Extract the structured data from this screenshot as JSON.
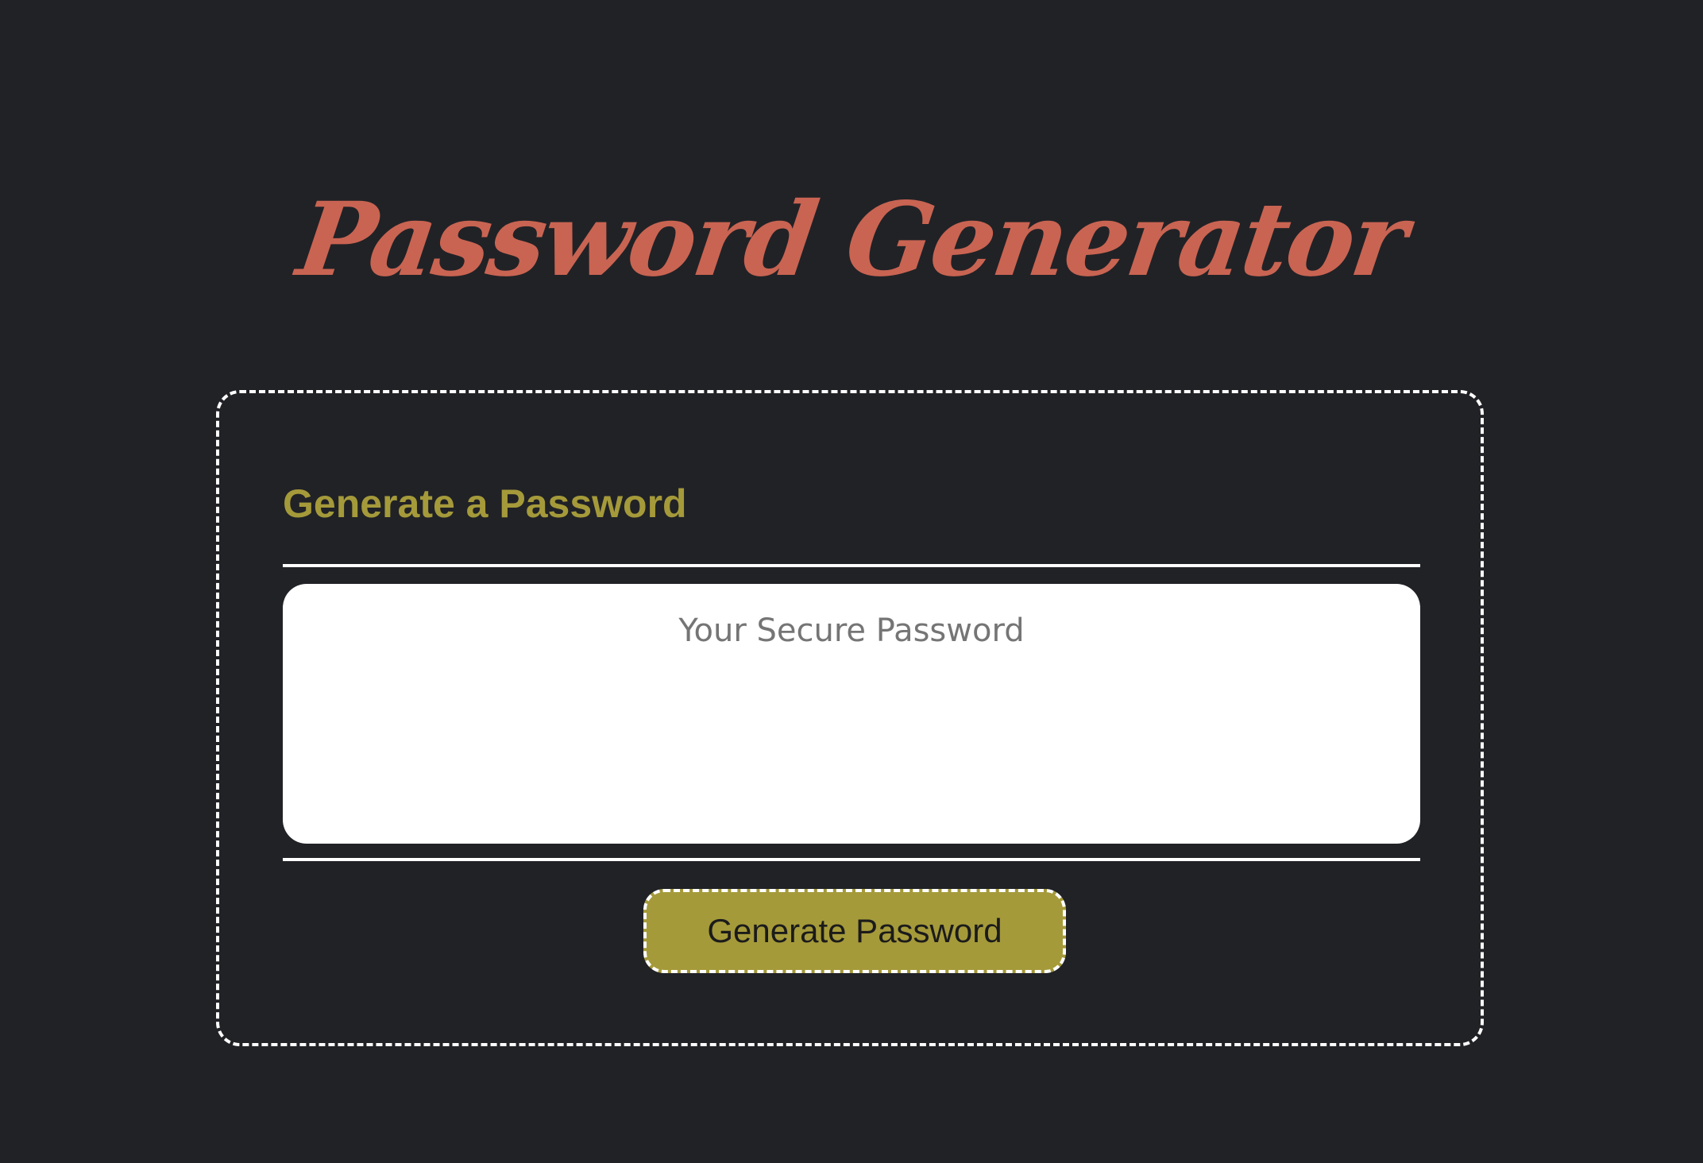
{
  "page": {
    "title": "Password Generator"
  },
  "card": {
    "header": "Generate a Password",
    "password": {
      "placeholder": "Your Secure Password",
      "value": ""
    },
    "generate_button_label": "Generate Password"
  },
  "colors": {
    "background": "#212226",
    "title": "#c96452",
    "accent": "#a59a3a",
    "card_border": "#ffffff",
    "textarea_bg": "#ffffff"
  }
}
